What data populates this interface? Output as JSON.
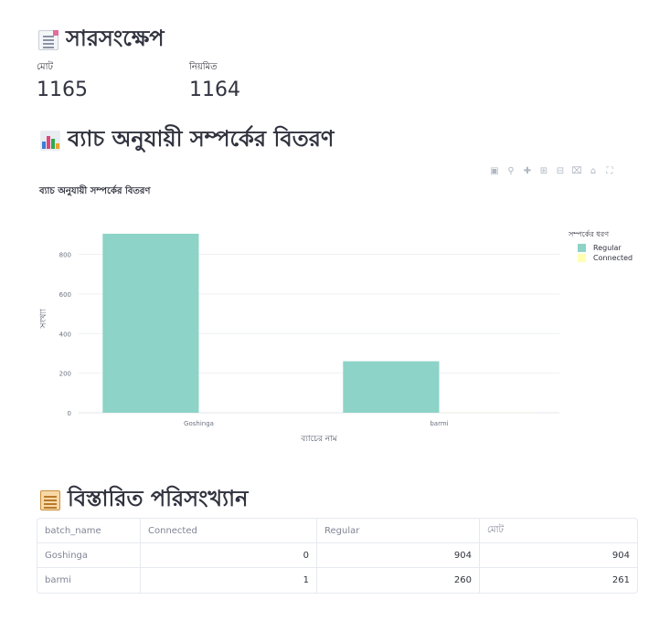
{
  "summary": {
    "heading": "সারসংক্ষেপ",
    "heading_icon": "page-facing-up-icon",
    "metrics": [
      {
        "label": "মোট",
        "value": "1165"
      },
      {
        "label": "নিয়মিত",
        "value": "1164"
      }
    ]
  },
  "distribution": {
    "heading": "ব্যাচ অনুযায়ী সম্পর্কের বিতরণ",
    "heading_icon": "bar-chart-icon"
  },
  "toolbar": {
    "icons": [
      "camera-icon",
      "zoom-icon",
      "pan-icon",
      "zoom-in-icon",
      "zoom-out-icon",
      "autoscale-icon",
      "home-icon",
      "fullscreen-icon"
    ]
  },
  "chart_data": {
    "type": "bar",
    "title": "ব্যাচ অনুযায়ী সম্পর্কের বিতরণ",
    "xlabel": "ব্যাচের নাম",
    "ylabel": "সংখ্যা",
    "categories": [
      "Goshinga",
      "barmi"
    ],
    "series": [
      {
        "name": "Regular",
        "color": "#8dd3c7",
        "values": [
          904,
          260
        ]
      },
      {
        "name": "Connected",
        "color": "#ffffb3",
        "values": [
          0,
          1
        ]
      }
    ],
    "ylim": [
      0,
      950
    ],
    "yticks": [
      0,
      200,
      400,
      600,
      800
    ],
    "legend_title": "সম্পর্কের ধরণ",
    "legend_position": "top-right",
    "grid": true
  },
  "details": {
    "heading": "বিস্তারিত পরিসংখ্যান",
    "heading_icon": "clipboard-icon",
    "columns": [
      "batch_name",
      "Connected",
      "Regular",
      "মোট"
    ],
    "rows": [
      [
        "Goshinga",
        "0",
        "904",
        "904"
      ],
      [
        "barmi",
        "1",
        "260",
        "261"
      ]
    ]
  }
}
